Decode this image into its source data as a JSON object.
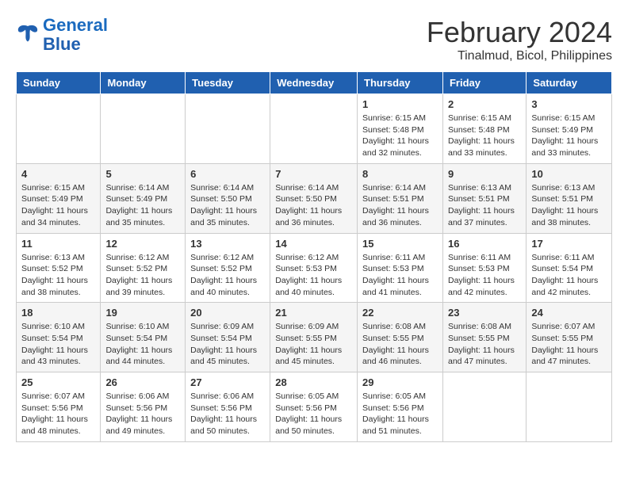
{
  "header": {
    "logo_line1": "General",
    "logo_line2": "Blue",
    "month": "February 2024",
    "location": "Tinalmud, Bicol, Philippines"
  },
  "columns": [
    "Sunday",
    "Monday",
    "Tuesday",
    "Wednesday",
    "Thursday",
    "Friday",
    "Saturday"
  ],
  "weeks": [
    [
      {
        "day": "",
        "info": ""
      },
      {
        "day": "",
        "info": ""
      },
      {
        "day": "",
        "info": ""
      },
      {
        "day": "",
        "info": ""
      },
      {
        "day": "1",
        "info": "Sunrise: 6:15 AM\nSunset: 5:48 PM\nDaylight: 11 hours and 32 minutes."
      },
      {
        "day": "2",
        "info": "Sunrise: 6:15 AM\nSunset: 5:48 PM\nDaylight: 11 hours and 33 minutes."
      },
      {
        "day": "3",
        "info": "Sunrise: 6:15 AM\nSunset: 5:49 PM\nDaylight: 11 hours and 33 minutes."
      }
    ],
    [
      {
        "day": "4",
        "info": "Sunrise: 6:15 AM\nSunset: 5:49 PM\nDaylight: 11 hours and 34 minutes."
      },
      {
        "day": "5",
        "info": "Sunrise: 6:14 AM\nSunset: 5:49 PM\nDaylight: 11 hours and 35 minutes."
      },
      {
        "day": "6",
        "info": "Sunrise: 6:14 AM\nSunset: 5:50 PM\nDaylight: 11 hours and 35 minutes."
      },
      {
        "day": "7",
        "info": "Sunrise: 6:14 AM\nSunset: 5:50 PM\nDaylight: 11 hours and 36 minutes."
      },
      {
        "day": "8",
        "info": "Sunrise: 6:14 AM\nSunset: 5:51 PM\nDaylight: 11 hours and 36 minutes."
      },
      {
        "day": "9",
        "info": "Sunrise: 6:13 AM\nSunset: 5:51 PM\nDaylight: 11 hours and 37 minutes."
      },
      {
        "day": "10",
        "info": "Sunrise: 6:13 AM\nSunset: 5:51 PM\nDaylight: 11 hours and 38 minutes."
      }
    ],
    [
      {
        "day": "11",
        "info": "Sunrise: 6:13 AM\nSunset: 5:52 PM\nDaylight: 11 hours and 38 minutes."
      },
      {
        "day": "12",
        "info": "Sunrise: 6:12 AM\nSunset: 5:52 PM\nDaylight: 11 hours and 39 minutes."
      },
      {
        "day": "13",
        "info": "Sunrise: 6:12 AM\nSunset: 5:52 PM\nDaylight: 11 hours and 40 minutes."
      },
      {
        "day": "14",
        "info": "Sunrise: 6:12 AM\nSunset: 5:53 PM\nDaylight: 11 hours and 40 minutes."
      },
      {
        "day": "15",
        "info": "Sunrise: 6:11 AM\nSunset: 5:53 PM\nDaylight: 11 hours and 41 minutes."
      },
      {
        "day": "16",
        "info": "Sunrise: 6:11 AM\nSunset: 5:53 PM\nDaylight: 11 hours and 42 minutes."
      },
      {
        "day": "17",
        "info": "Sunrise: 6:11 AM\nSunset: 5:54 PM\nDaylight: 11 hours and 42 minutes."
      }
    ],
    [
      {
        "day": "18",
        "info": "Sunrise: 6:10 AM\nSunset: 5:54 PM\nDaylight: 11 hours and 43 minutes."
      },
      {
        "day": "19",
        "info": "Sunrise: 6:10 AM\nSunset: 5:54 PM\nDaylight: 11 hours and 44 minutes."
      },
      {
        "day": "20",
        "info": "Sunrise: 6:09 AM\nSunset: 5:54 PM\nDaylight: 11 hours and 45 minutes."
      },
      {
        "day": "21",
        "info": "Sunrise: 6:09 AM\nSunset: 5:55 PM\nDaylight: 11 hours and 45 minutes."
      },
      {
        "day": "22",
        "info": "Sunrise: 6:08 AM\nSunset: 5:55 PM\nDaylight: 11 hours and 46 minutes."
      },
      {
        "day": "23",
        "info": "Sunrise: 6:08 AM\nSunset: 5:55 PM\nDaylight: 11 hours and 47 minutes."
      },
      {
        "day": "24",
        "info": "Sunrise: 6:07 AM\nSunset: 5:55 PM\nDaylight: 11 hours and 47 minutes."
      }
    ],
    [
      {
        "day": "25",
        "info": "Sunrise: 6:07 AM\nSunset: 5:56 PM\nDaylight: 11 hours and 48 minutes."
      },
      {
        "day": "26",
        "info": "Sunrise: 6:06 AM\nSunset: 5:56 PM\nDaylight: 11 hours and 49 minutes."
      },
      {
        "day": "27",
        "info": "Sunrise: 6:06 AM\nSunset: 5:56 PM\nDaylight: 11 hours and 50 minutes."
      },
      {
        "day": "28",
        "info": "Sunrise: 6:05 AM\nSunset: 5:56 PM\nDaylight: 11 hours and 50 minutes."
      },
      {
        "day": "29",
        "info": "Sunrise: 6:05 AM\nSunset: 5:56 PM\nDaylight: 11 hours and 51 minutes."
      },
      {
        "day": "",
        "info": ""
      },
      {
        "day": "",
        "info": ""
      }
    ]
  ]
}
